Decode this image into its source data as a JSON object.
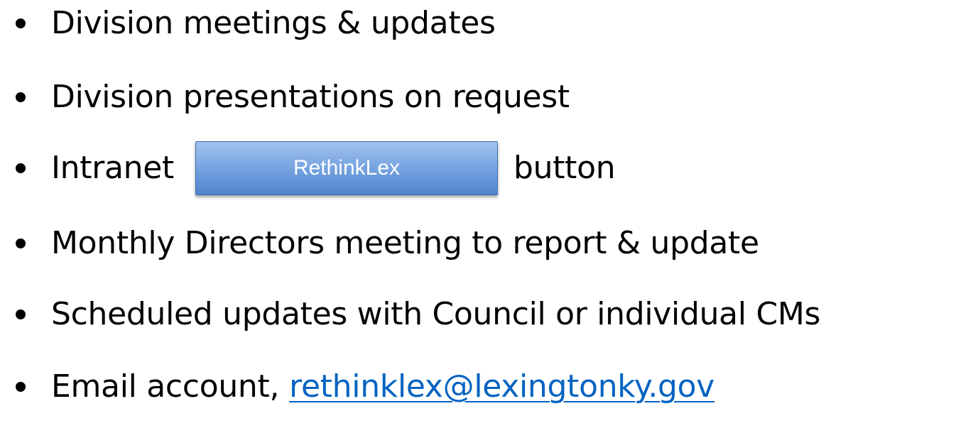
{
  "bullets": [
    {
      "text": "Division meetings & updates"
    },
    {
      "text": "Division presentations on request"
    },
    {
      "before": "Intranet",
      "button_label": "RethinkLex",
      "after": "button"
    },
    {
      "text": "Monthly Directors meeting to report & update"
    },
    {
      "text": "Scheduled updates with Council or individual CMs"
    },
    {
      "before": "Email account,",
      "link": "rethinklex@lexingtonky.gov"
    }
  ],
  "colors": {
    "text": "#000000",
    "link": "#0563c1",
    "button_top": "#a3c3ee",
    "button_bottom": "#4f84cd",
    "button_border": "#3a6fb5",
    "button_text": "#ffffff"
  }
}
